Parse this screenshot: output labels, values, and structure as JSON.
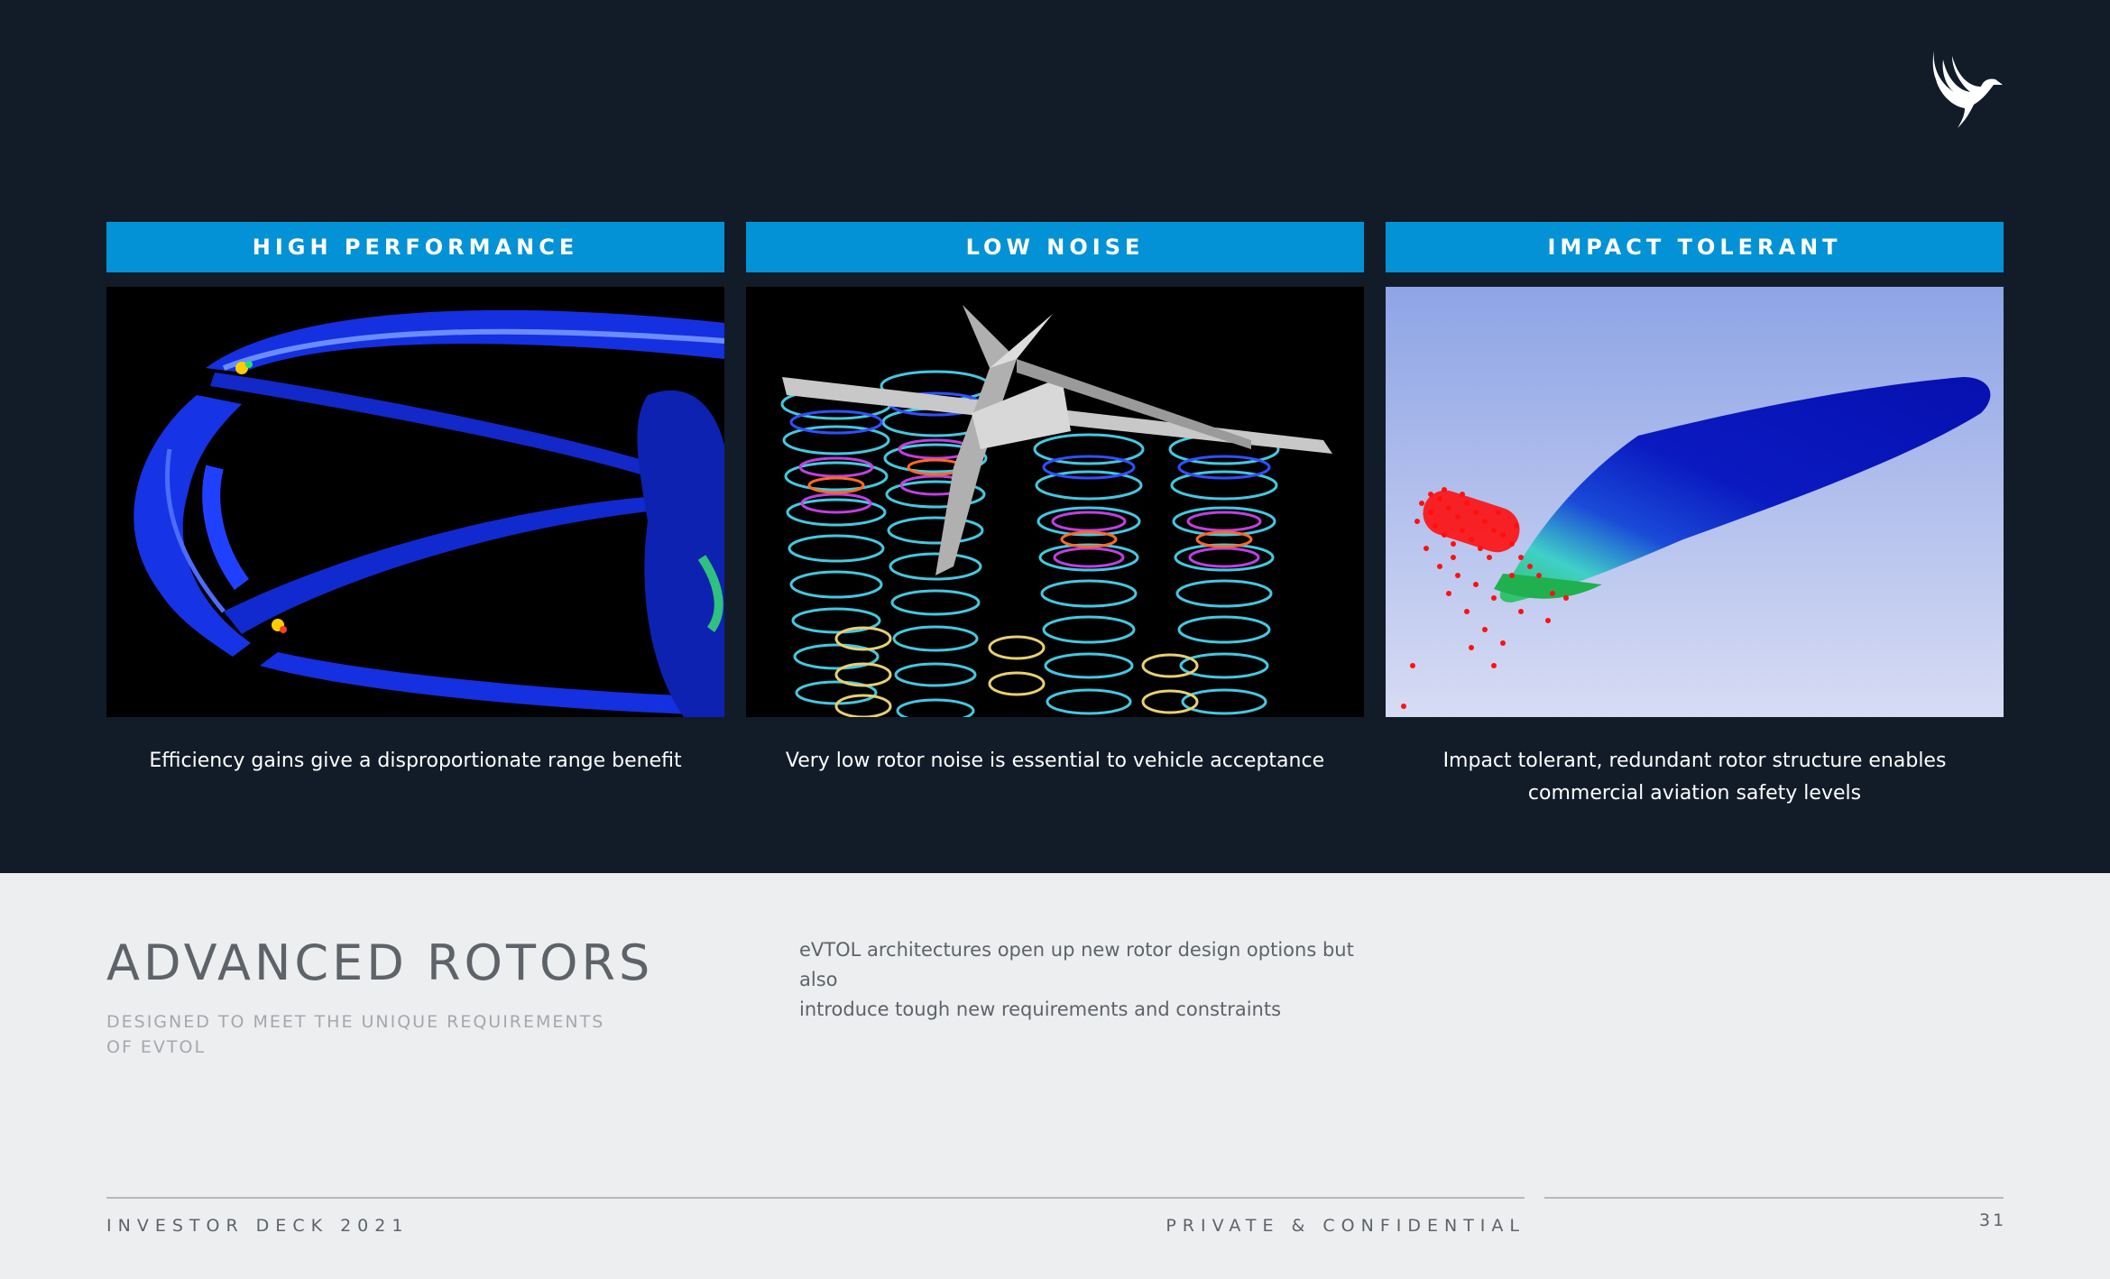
{
  "logo": {
    "icon": "bird-logo-icon"
  },
  "cards": [
    {
      "header": "HIGH PERFORMANCE",
      "image": "rotor-blade-pressure-simulation",
      "caption": "Efficiency gains give a disproportionate range benefit"
    },
    {
      "header": "LOW NOISE",
      "image": "rotor-wake-vortex-simulation",
      "caption": "Very low rotor noise is essential to vehicle acceptance"
    },
    {
      "header": "IMPACT TOLERANT",
      "image": "blade-impact-simulation",
      "caption_line1": "Impact tolerant, redundant rotor structure enables",
      "caption_line2": "commercial aviation safety levels"
    }
  ],
  "section": {
    "title": "ADVANCED ROTORS",
    "subtitle_line1": "DESIGNED TO MEET THE UNIQUE REQUIREMENTS",
    "subtitle_line2": "OF EVTOL",
    "description_line1": "eVTOL architectures open up new rotor design options but also",
    "description_line2": "introduce tough new requirements and constraints"
  },
  "footer": {
    "left": "INVESTOR DECK 2021",
    "middle": "PRIVATE & CONFIDENTIAL",
    "page_number": "31"
  },
  "colors": {
    "top_background": "#111c28",
    "header_blue": "#0492d6",
    "bottom_background": "#edeef0",
    "text_gray": "#5e6369"
  }
}
